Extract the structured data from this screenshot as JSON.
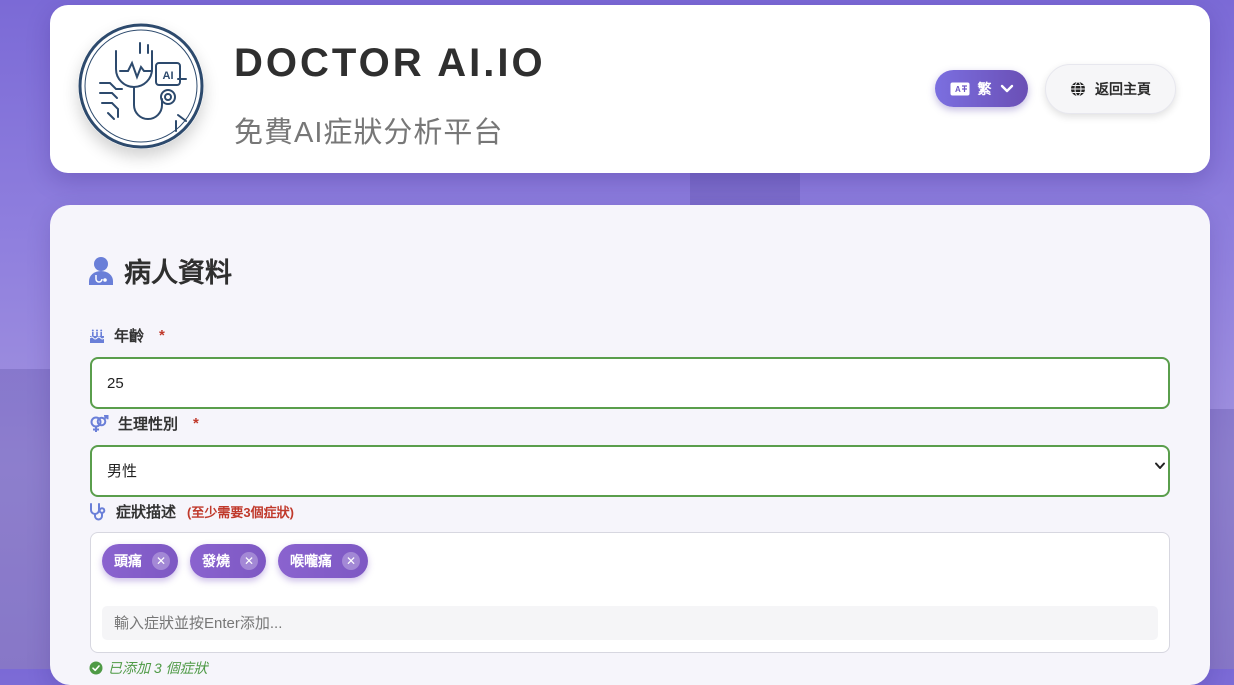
{
  "header": {
    "brand_title": "DOCTOR AI.IO",
    "brand_subtitle": "免費AI症狀分析平台",
    "logo_icon": "doctor-ai-stethoscope-circuit-logo",
    "lang_button": {
      "label": "繁",
      "icon": "translate-icon"
    },
    "home_button": {
      "label": "返回主頁",
      "icon": "globe-icon"
    }
  },
  "form": {
    "section_title": "病人資料",
    "section_icon": "user-doctor-icon",
    "age": {
      "label": "年齡",
      "required_mark": "*",
      "value": "25",
      "icon": "birthday-cake-icon"
    },
    "gender": {
      "label": "生理性別",
      "required_mark": "*",
      "selected": "男性",
      "options": [
        "男性"
      ],
      "icon": "venus-mars-icon"
    },
    "symptoms": {
      "label": "症狀描述",
      "hint": "(至少需要3個症狀)",
      "icon": "stethoscope-icon",
      "tags": [
        "頭痛",
        "發燒",
        "喉嚨痛"
      ],
      "remove_glyph": "✕",
      "input_placeholder": "輸入症狀並按Enter添加...",
      "status_text": "已添加 3 個症狀",
      "status_icon": "check-circle-icon"
    }
  },
  "colors": {
    "accent_purple": "#7b5fd0",
    "valid_green": "#5a9e4c",
    "required_red": "#c0392b",
    "icon_blue": "#6a7fd8"
  }
}
